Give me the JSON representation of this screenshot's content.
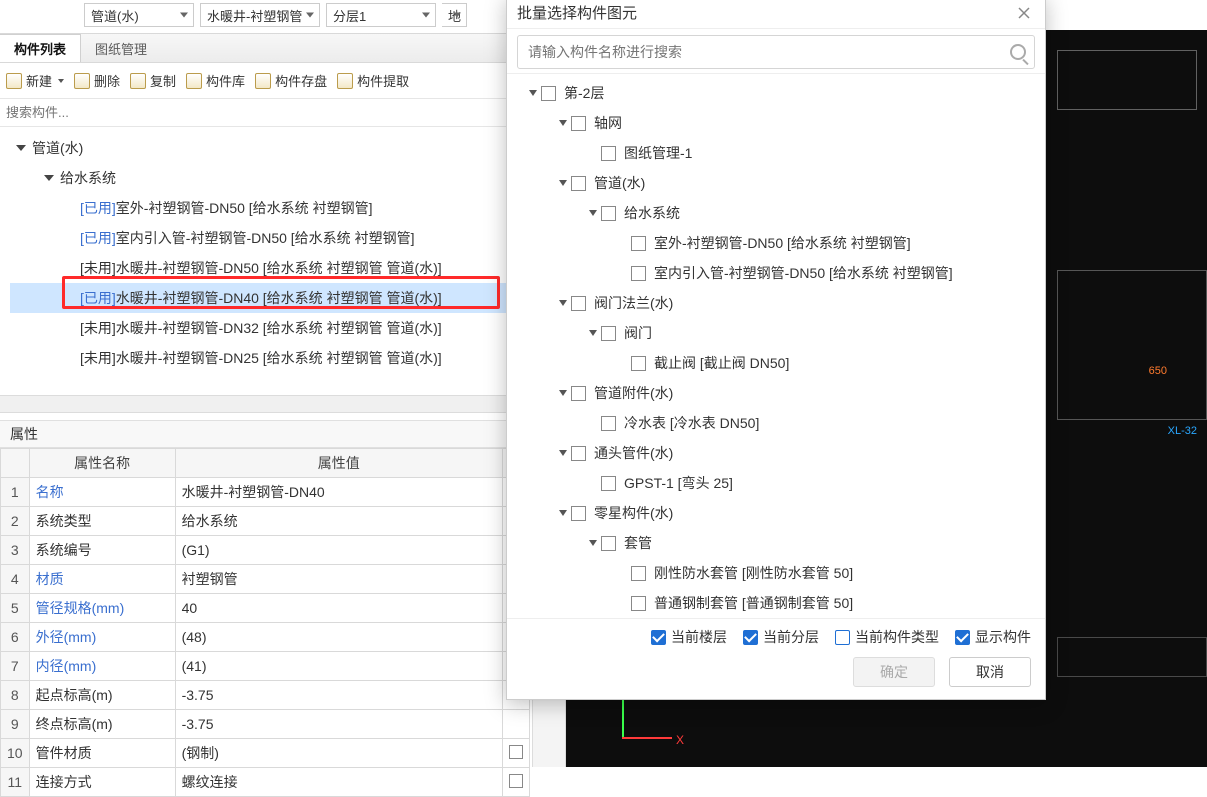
{
  "top": {
    "dd1": "管道(水)",
    "dd2": "水暖井-衬塑钢管",
    "dd3": "分层1",
    "dd4": "地"
  },
  "tabs": {
    "t0": "构件列表",
    "t1": "图纸管理"
  },
  "toolbar": {
    "new": "新建",
    "delete": "删除",
    "copy": "复制",
    "lib": "构件库",
    "save": "构件存盘",
    "extract": "构件提取"
  },
  "search_placeholder": "搜索构件...",
  "tree": {
    "lvl0": "管道(水)",
    "lvl1": "给水系统",
    "items": [
      {
        "pre": "[已用]",
        "text": "室外-衬塑钢管-DN50 [给水系统 衬塑钢管]"
      },
      {
        "pre": "[已用]",
        "text": "室内引入管-衬塑钢管-DN50 [给水系统 衬塑钢管]"
      },
      {
        "pre": "[未用]",
        "text": "水暖井-衬塑钢管-DN50 [给水系统 衬塑钢管 管道(水)]"
      },
      {
        "pre": "[已用]",
        "text": "水暖井-衬塑钢管-DN40 [给水系统 衬塑钢管 管道(水)]"
      },
      {
        "pre": "[未用]",
        "text": "水暖井-衬塑钢管-DN32 [给水系统 衬塑钢管 管道(水)]"
      },
      {
        "pre": "[未用]",
        "text": "水暖井-衬塑钢管-DN25 [给水系统 衬塑钢管 管道(水)]"
      }
    ]
  },
  "attr": {
    "title": "属性",
    "head_name": "属性名称",
    "head_value": "属性值",
    "rows": [
      {
        "i": "1",
        "n": "名称",
        "v": "水暖井-衬塑钢管-DN40",
        "lk": true
      },
      {
        "i": "2",
        "n": "系统类型",
        "v": "给水系统"
      },
      {
        "i": "3",
        "n": "系统编号",
        "v": "(G1)"
      },
      {
        "i": "4",
        "n": "材质",
        "v": "衬塑钢管",
        "lk": true
      },
      {
        "i": "5",
        "n": "管径规格(mm)",
        "v": "40",
        "lk": true
      },
      {
        "i": "6",
        "n": "外径(mm)",
        "v": "(48)",
        "lk": true
      },
      {
        "i": "7",
        "n": "内径(mm)",
        "v": "(41)",
        "lk": true
      },
      {
        "i": "8",
        "n": "起点标高(m)",
        "v": "-3.75"
      },
      {
        "i": "9",
        "n": "终点标高(m)",
        "v": "-3.75"
      },
      {
        "i": "10",
        "n": "管件材质",
        "v": "(钢制)",
        "cb": true
      },
      {
        "i": "11",
        "n": "连接方式",
        "v": "螺纹连接",
        "cb": true
      }
    ]
  },
  "canvas": {
    "tag1": "650",
    "tag2": "XL-32"
  },
  "dialog": {
    "title": "批量选择构件图元",
    "search_placeholder": "请输入构件名称进行搜索",
    "tree": [
      {
        "d": 0,
        "tg": "open",
        "label": "第-2层"
      },
      {
        "d": 1,
        "tg": "open",
        "label": "轴网"
      },
      {
        "d": 2,
        "tg": "",
        "label": "图纸管理-1"
      },
      {
        "d": 1,
        "tg": "open",
        "label": "管道(水)"
      },
      {
        "d": 2,
        "tg": "open",
        "label": "给水系统"
      },
      {
        "d": 3,
        "tg": "",
        "label": "室外-衬塑钢管-DN50 [给水系统 衬塑钢管]"
      },
      {
        "d": 3,
        "tg": "",
        "label": "室内引入管-衬塑钢管-DN50 [给水系统 衬塑钢管]"
      },
      {
        "d": 1,
        "tg": "open",
        "label": "阀门法兰(水)"
      },
      {
        "d": 2,
        "tg": "open",
        "label": "阀门"
      },
      {
        "d": 3,
        "tg": "",
        "label": "截止阀 [截止阀 DN50]"
      },
      {
        "d": 1,
        "tg": "open",
        "label": "管道附件(水)"
      },
      {
        "d": 2,
        "tg": "",
        "label": "冷水表 [冷水表 DN50]"
      },
      {
        "d": 1,
        "tg": "open",
        "label": "通头管件(水)"
      },
      {
        "d": 2,
        "tg": "",
        "label": "GPST-1 [弯头 25]"
      },
      {
        "d": 1,
        "tg": "open",
        "label": "零星构件(水)"
      },
      {
        "d": 2,
        "tg": "open",
        "label": "套管"
      },
      {
        "d": 3,
        "tg": "",
        "label": "刚性防水套管 [刚性防水套管 50]"
      },
      {
        "d": 3,
        "tg": "",
        "label": "普通钢制套管 [普通钢制套管 50]"
      }
    ],
    "chk": {
      "c1": "当前楼层",
      "c2": "当前分层",
      "c3": "当前构件类型",
      "c4": "显示构件"
    },
    "btn_ok": "确定",
    "btn_cancel": "取消"
  }
}
